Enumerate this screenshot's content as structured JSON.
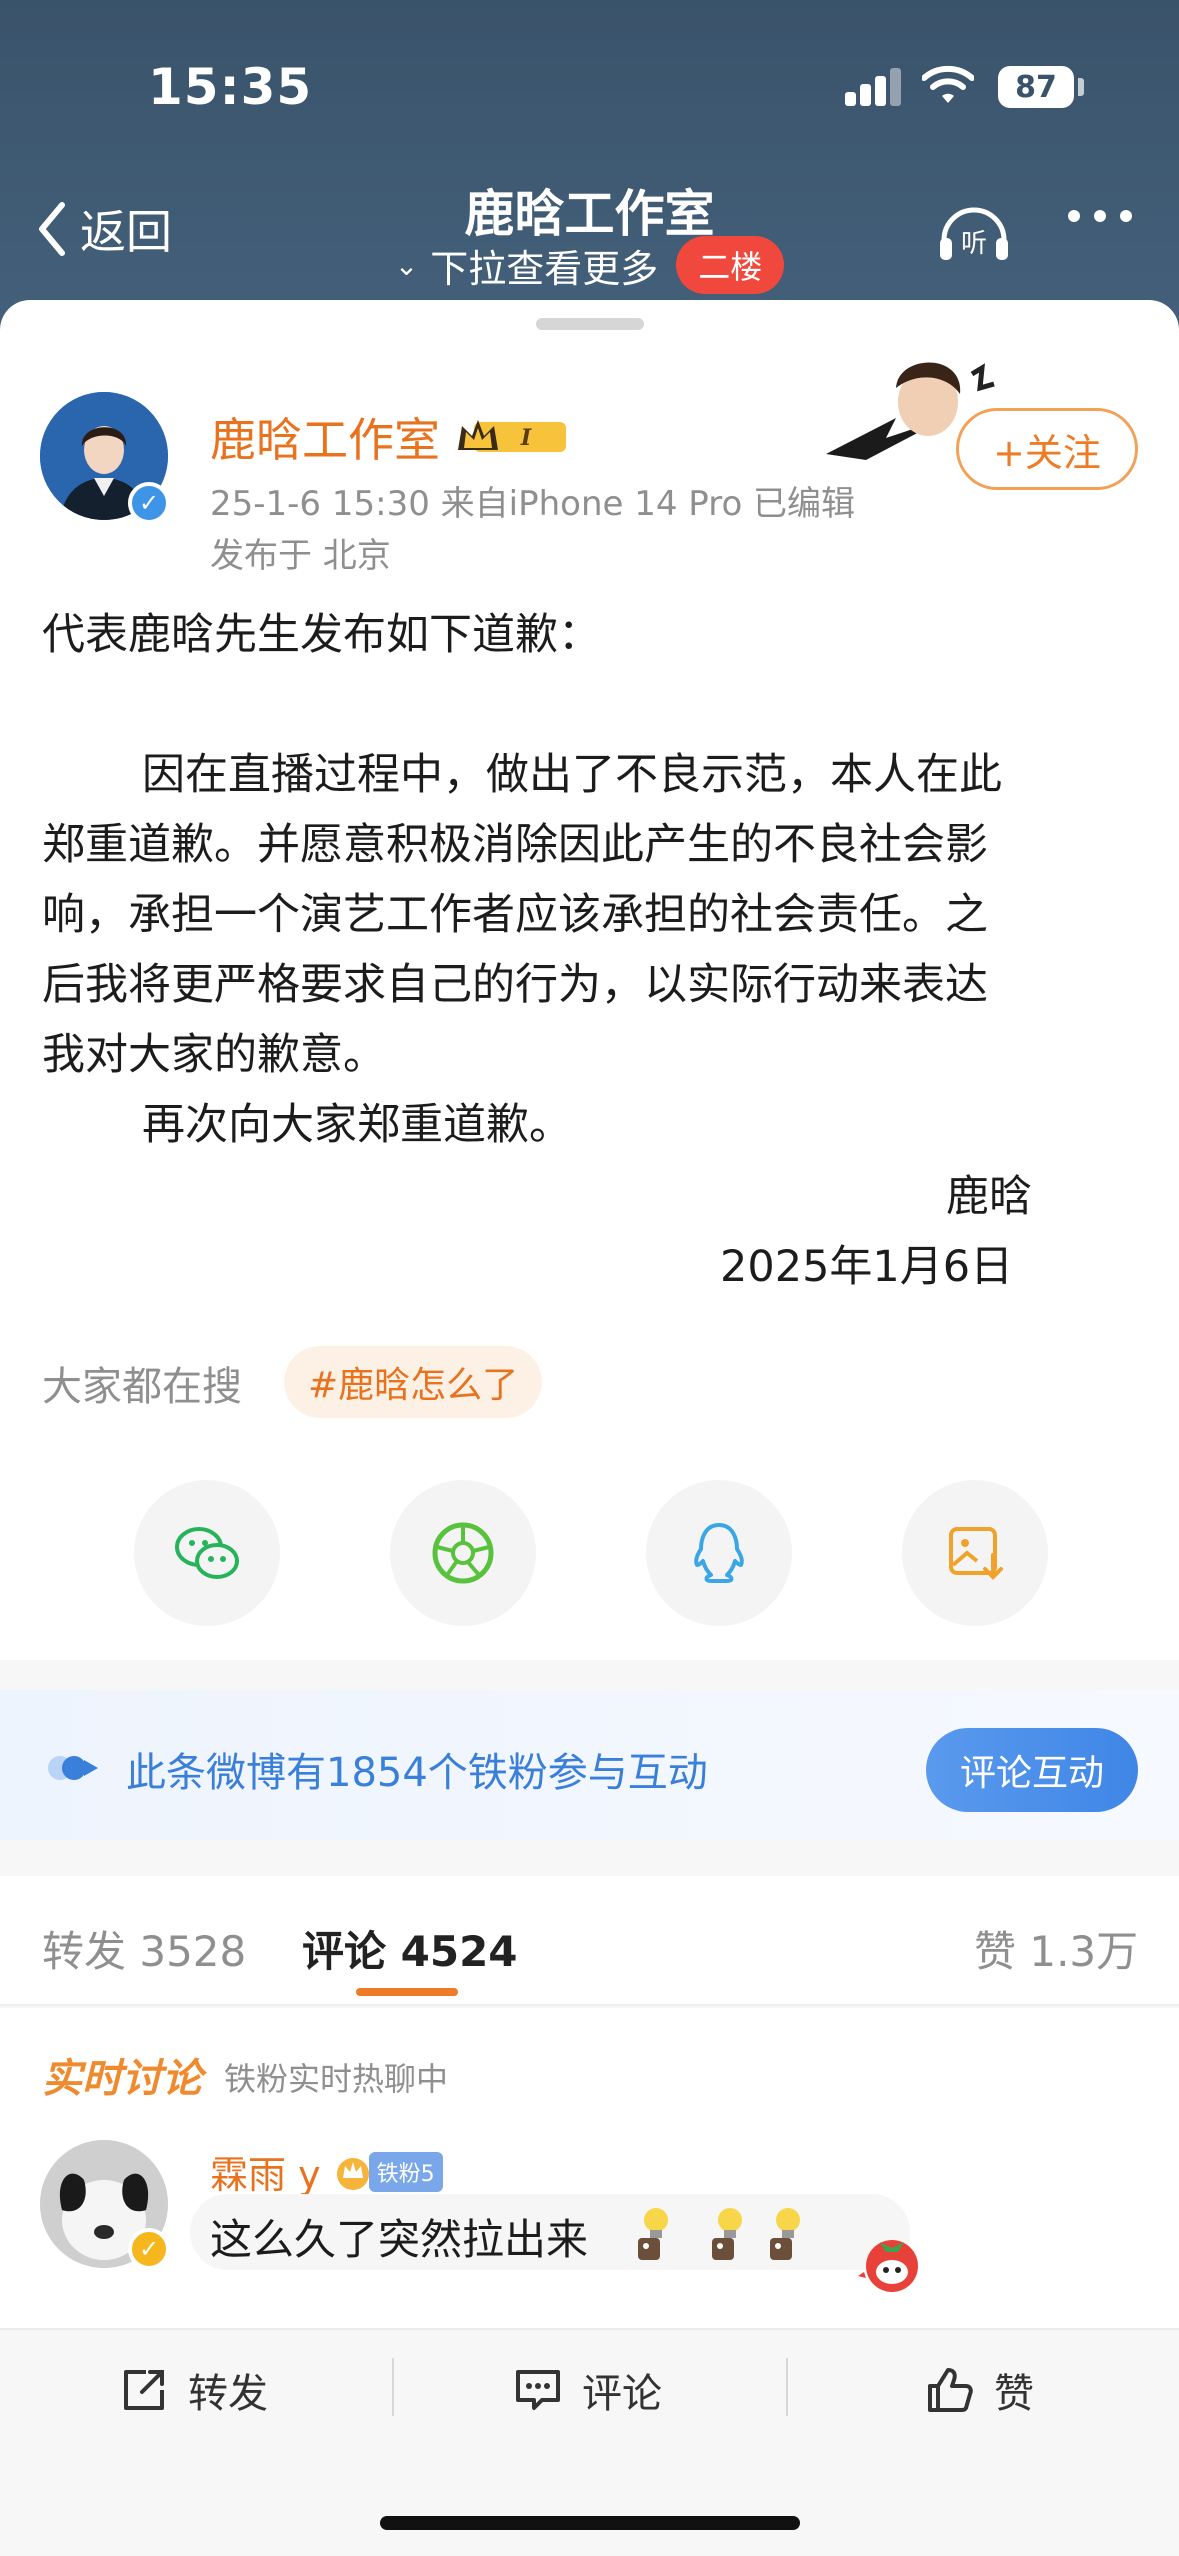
{
  "status_bar": {
    "time": "15:35",
    "battery": "87"
  },
  "nav": {
    "back_label": "返回",
    "title": "鹿晗工作室",
    "subtitle": "下拉查看更多",
    "floor_badge": "二楼",
    "listen_label": "听"
  },
  "post": {
    "author": "鹿晗工作室",
    "member_level": "I",
    "meta": "25-1-6 15:30  来自iPhone 14 Pro  已编辑",
    "location": "发布于 北京",
    "follow_label": "+关注",
    "lines": [
      "代表鹿晗先生发布如下道歉：",
      "因在直播过程中，做出了不良示范，本人在此",
      "郑重道歉。并愿意积极消除因此产生的不良社会影",
      "响，承担一个演艺工作者应该承担的社会责任。之",
      "后我将更严格要求自己的行为，以实际行动来表达",
      "我对大家的歉意。",
      "再次向大家郑重道歉。"
    ],
    "signature_name": "鹿晗",
    "signature_date": "2025年1月6日"
  },
  "search": {
    "label": "大家都在搜",
    "topic": "#鹿晗怎么了"
  },
  "share_icons": [
    "wechat-icon",
    "moments-icon",
    "qq-icon",
    "save-image-icon"
  ],
  "fan_bar": {
    "text": "此条微博有1854个铁粉参与互动",
    "button": "评论互动"
  },
  "tabs": {
    "repost": "转发 3528",
    "comment": "评论 4524",
    "like": "赞 1.3万"
  },
  "live": {
    "title": "实时讨论",
    "subtitle": "铁粉实时热聊中",
    "comment": {
      "user": "霖雨 y",
      "fan_badge": "铁粉5",
      "text": "这么久了突然拉出来"
    }
  },
  "toolbar": {
    "repost": "转发",
    "comment": "评论",
    "like": "赞"
  },
  "colors": {
    "accent_orange": "#ee7b26",
    "nav_bg": "#3a536b",
    "link_blue": "#3a7fd9"
  }
}
